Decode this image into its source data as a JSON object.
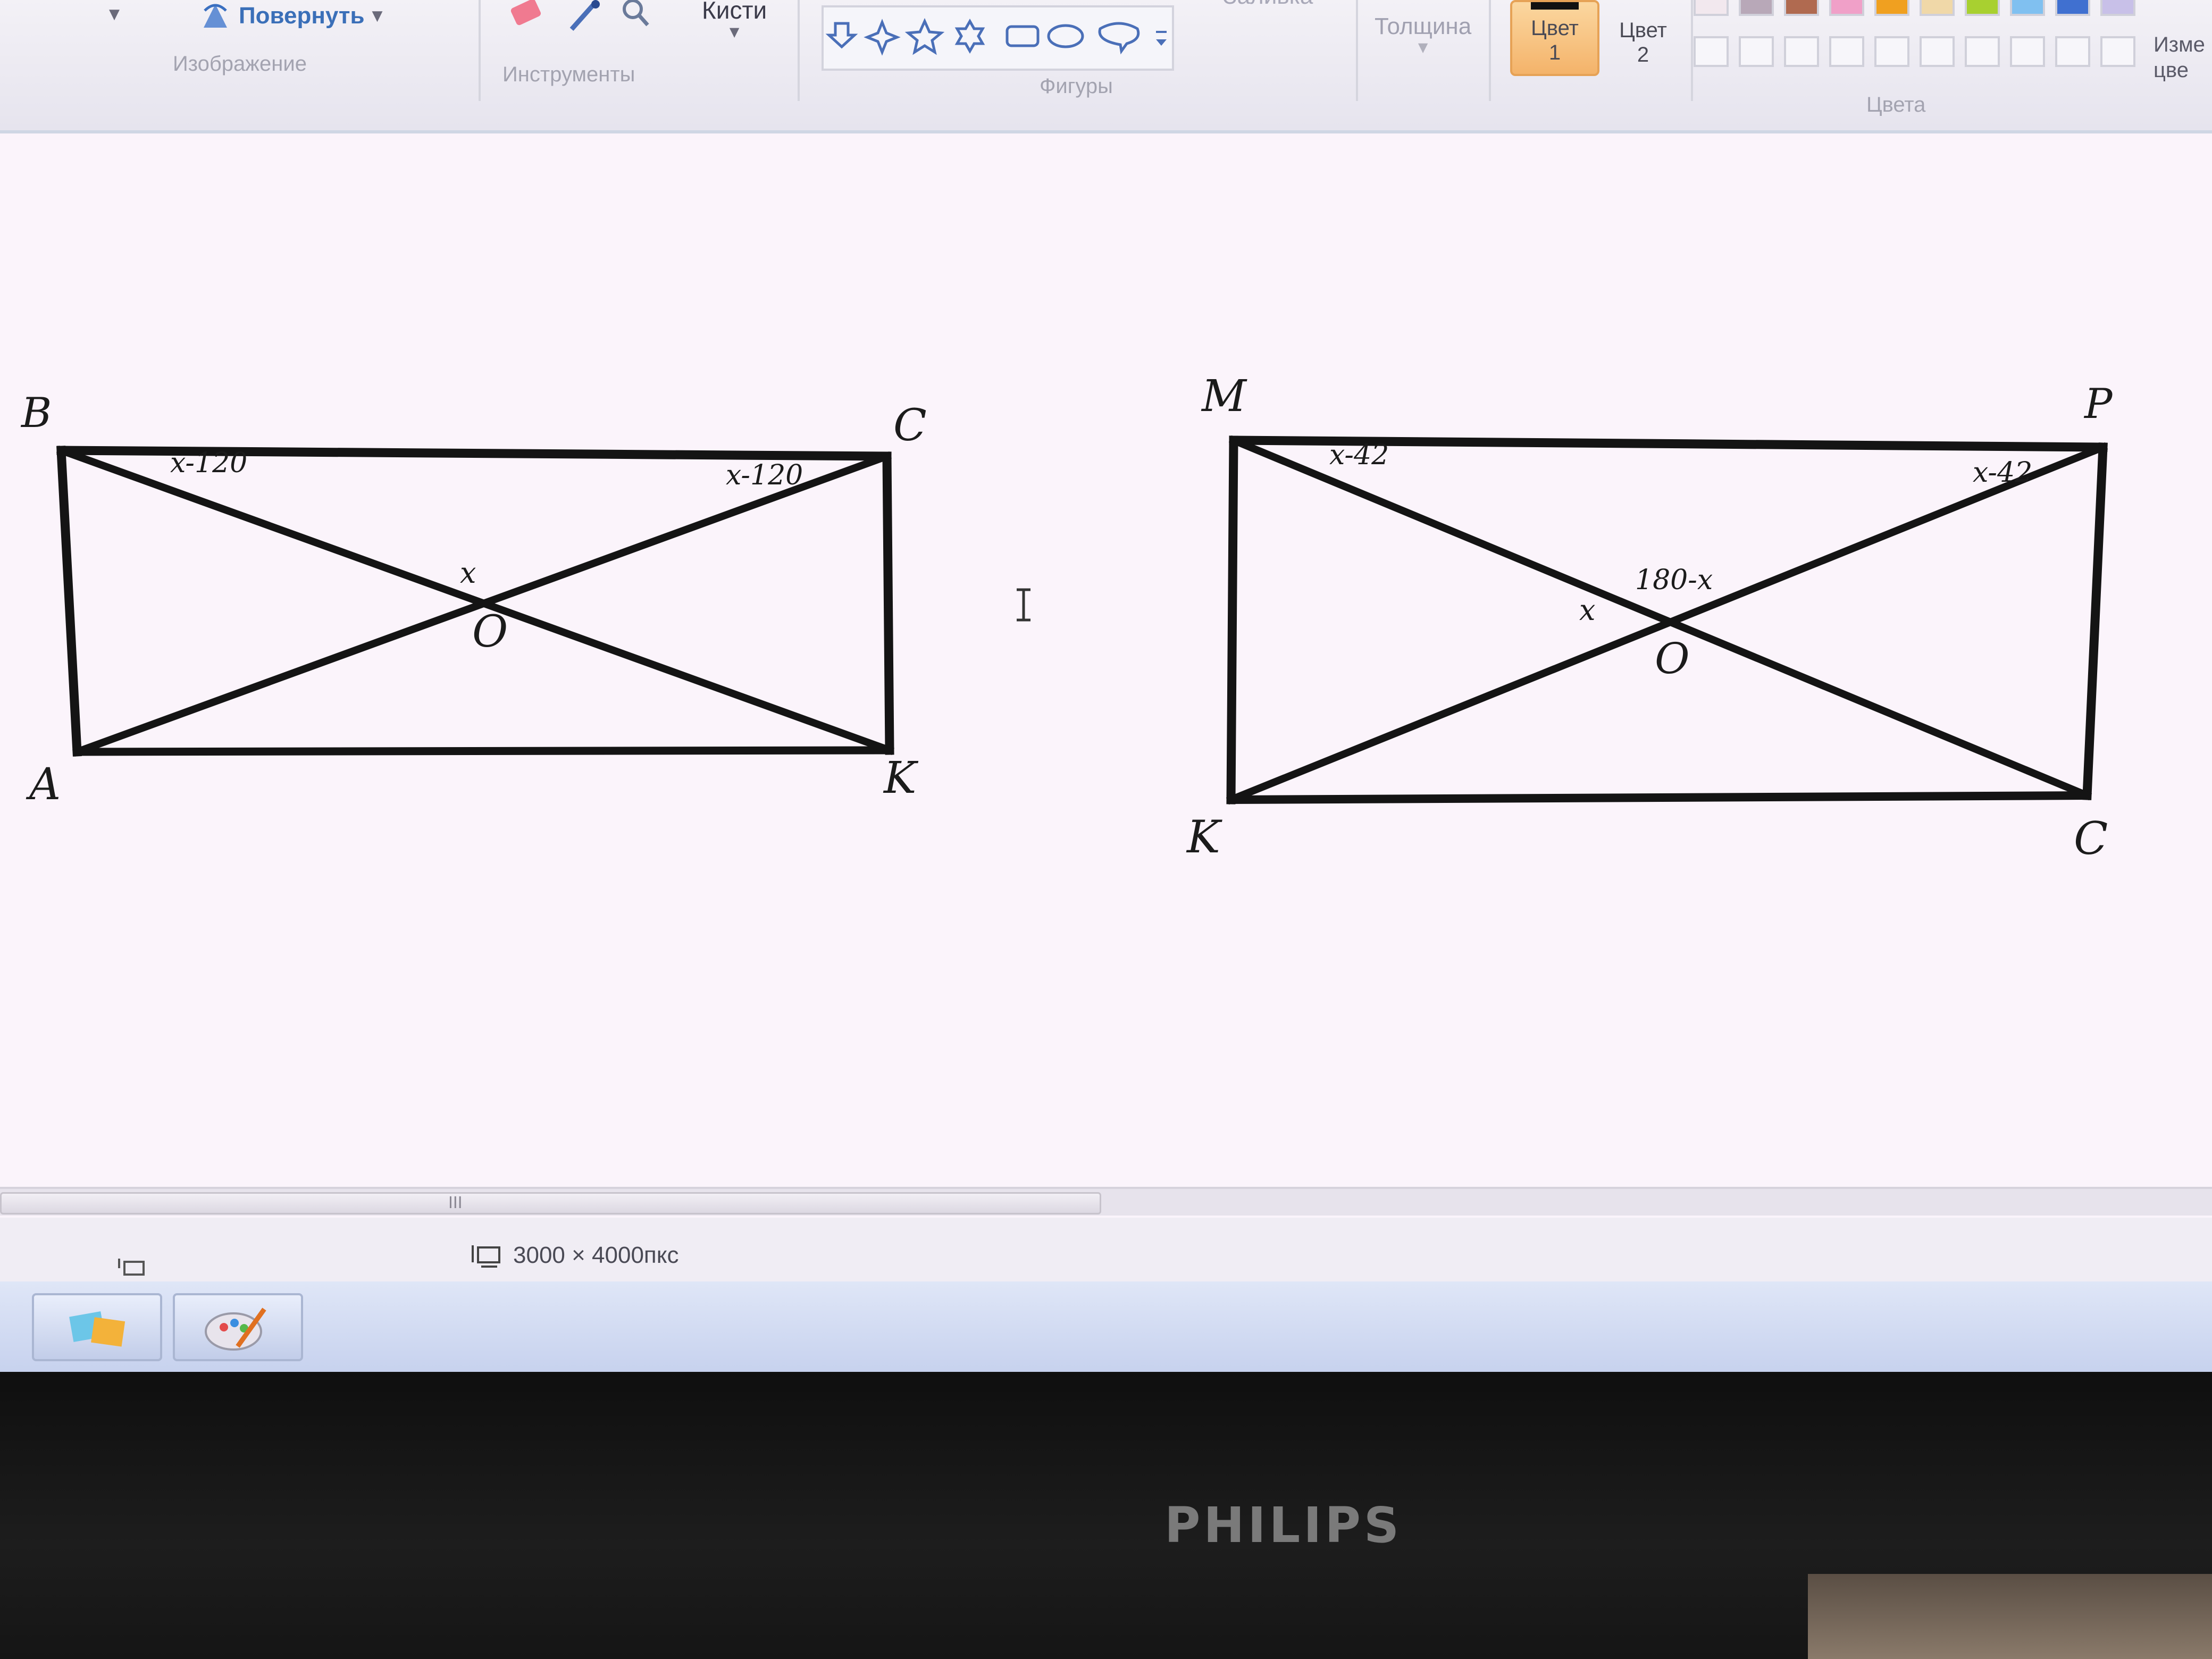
{
  "ribbon": {
    "rotate_label": "Повернуть",
    "group_image": "Изображение",
    "group_tools": "Инструменты",
    "brushes_label": "Кисти",
    "fill_label": "Заливка",
    "group_shapes": "Фигуры",
    "thickness_label": "Толщина",
    "color1_label": "Цвет",
    "color1_num": "1",
    "color2_label": "Цвет",
    "color2_num": "2",
    "group_colors": "Цвета",
    "edit_colors_label_line1": "Изме",
    "edit_colors_label_line2": "цве",
    "palette_row1": [
      "#f2e8ee",
      "#b8a8b8",
      "#b06a50",
      "#f0a0c8",
      "#f0a020",
      "#f0d8a8",
      "#a8d030",
      "#80c0f0",
      "#4070d0",
      "#c8c0e8"
    ],
    "color1_value": "#111111"
  },
  "figure1": {
    "vertex_B": "B",
    "vertex_C": "C",
    "vertex_A": "A",
    "vertex_K": "K",
    "center_O": "O",
    "angle_B": "x-120",
    "angle_C": "x-120",
    "angle_O": "x"
  },
  "figure2": {
    "vertex_M": "M",
    "vertex_P": "P",
    "vertex_K": "K",
    "vertex_C": "C",
    "center_O": "O",
    "angle_M": "x-42",
    "angle_P": "x-42",
    "angle_O_top": "180-x",
    "angle_O_left": "x"
  },
  "status": {
    "canvas_size": "3000 × 4000пкс"
  },
  "scrollbar": {
    "grip": "III"
  },
  "monitor": {
    "brand": "PHILIPS"
  },
  "icons": [
    "rotate-icon",
    "eraser-icon",
    "color-picker-icon",
    "magnifier-icon",
    "text-cursor-icon",
    "selection-size-icon",
    "canvas-size-icon",
    "file-manager-icon",
    "paint-icon"
  ]
}
